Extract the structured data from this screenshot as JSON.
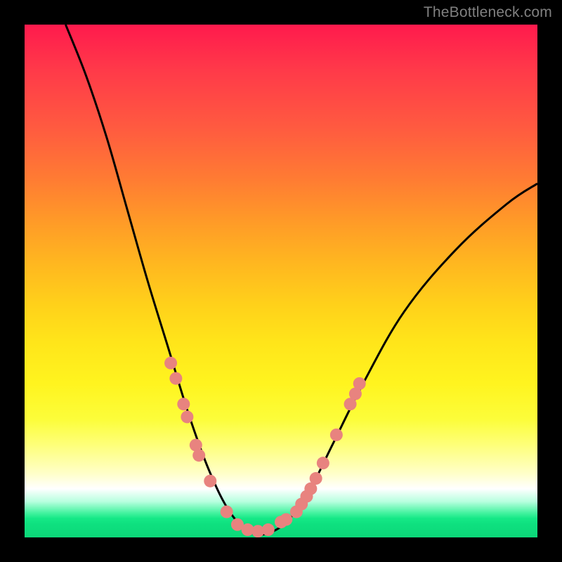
{
  "watermark": "TheBottleneck.com",
  "colors": {
    "curve_stroke": "#000000",
    "dot_fill": "#e8837f",
    "background": "#000000"
  },
  "chart_data": {
    "type": "line",
    "title": "",
    "xlabel": "",
    "ylabel": "",
    "xlim": [
      0,
      100
    ],
    "ylim": [
      0,
      100
    ],
    "curve": {
      "description": "V-shaped bottleneck curve; minimum near x≈45, rising steeply on both sides",
      "points": [
        {
          "x": 8,
          "y": 100
        },
        {
          "x": 12,
          "y": 90
        },
        {
          "x": 16,
          "y": 78
        },
        {
          "x": 20,
          "y": 64
        },
        {
          "x": 24,
          "y": 50
        },
        {
          "x": 28,
          "y": 37
        },
        {
          "x": 32,
          "y": 24
        },
        {
          "x": 36,
          "y": 13
        },
        {
          "x": 40,
          "y": 5
        },
        {
          "x": 44,
          "y": 1
        },
        {
          "x": 48,
          "y": 1
        },
        {
          "x": 52,
          "y": 4
        },
        {
          "x": 56,
          "y": 10
        },
        {
          "x": 60,
          "y": 18
        },
        {
          "x": 66,
          "y": 30
        },
        {
          "x": 74,
          "y": 44
        },
        {
          "x": 84,
          "y": 56
        },
        {
          "x": 94,
          "y": 65
        },
        {
          "x": 100,
          "y": 69
        }
      ]
    },
    "dots_left": [
      {
        "x": 28.5,
        "y": 34
      },
      {
        "x": 29.5,
        "y": 31
      },
      {
        "x": 31.0,
        "y": 26
      },
      {
        "x": 31.7,
        "y": 23.5
      },
      {
        "x": 33.4,
        "y": 18
      },
      {
        "x": 34.0,
        "y": 16
      },
      {
        "x": 36.2,
        "y": 11
      },
      {
        "x": 39.4,
        "y": 5
      }
    ],
    "dots_right": [
      {
        "x": 50.0,
        "y": 3
      },
      {
        "x": 51.0,
        "y": 3.5
      },
      {
        "x": 53.0,
        "y": 5
      },
      {
        "x": 54.0,
        "y": 6.5
      },
      {
        "x": 55.0,
        "y": 8
      },
      {
        "x": 55.8,
        "y": 9.5
      },
      {
        "x": 56.8,
        "y": 11.5
      },
      {
        "x": 58.2,
        "y": 14.5
      },
      {
        "x": 60.8,
        "y": 20
      },
      {
        "x": 63.5,
        "y": 26
      },
      {
        "x": 64.5,
        "y": 28
      },
      {
        "x": 65.3,
        "y": 30
      }
    ],
    "dots_bottom": [
      {
        "x": 41.5,
        "y": 2.5
      },
      {
        "x": 43.5,
        "y": 1.5
      },
      {
        "x": 45.5,
        "y": 1.2
      },
      {
        "x": 47.5,
        "y": 1.5
      }
    ]
  }
}
